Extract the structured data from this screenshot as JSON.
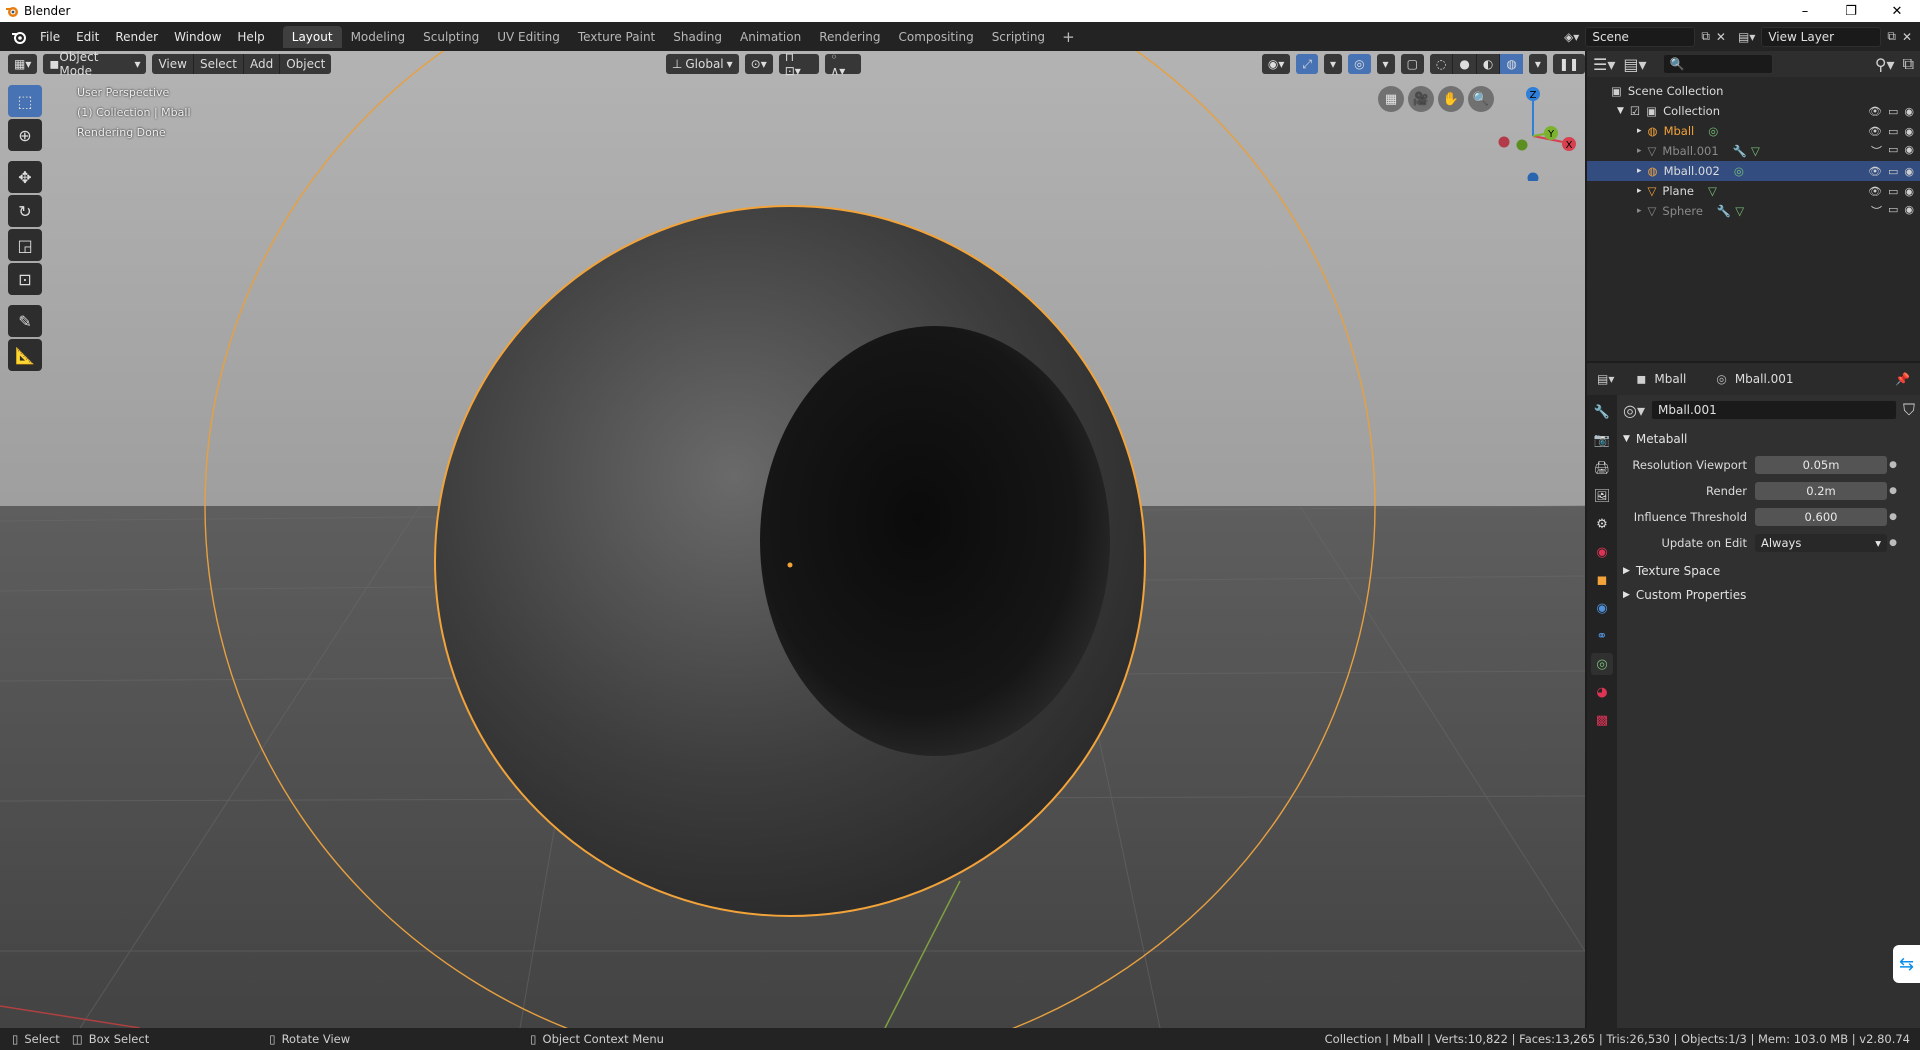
{
  "window": {
    "title": "Blender",
    "min": "–",
    "max": "❐",
    "close": "✕"
  },
  "topbar": {
    "menus": [
      "File",
      "Edit",
      "Render",
      "Window",
      "Help"
    ],
    "tabs": [
      "Layout",
      "Modeling",
      "Sculpting",
      "UV Editing",
      "Texture Paint",
      "Shading",
      "Animation",
      "Rendering",
      "Compositing",
      "Scripting"
    ],
    "active_tab": "Layout",
    "add_tab": "+",
    "scene": "Scene",
    "view_layer": "View Layer"
  },
  "viewport_header": {
    "mode": "Object Mode",
    "menus": [
      "View",
      "Select",
      "Add",
      "Object"
    ],
    "orientation": "Global"
  },
  "viewport_info": {
    "line1": "User Perspective",
    "line2": "(1) Collection | Mball",
    "line3": "Rendering Done"
  },
  "gizmo": {
    "z": "Z",
    "y": "Y",
    "x": "X"
  },
  "outliner": {
    "scene_collection": "Scene Collection",
    "collection": "Collection",
    "items": [
      {
        "name": "Mball",
        "selected": false,
        "active": true,
        "hidden": false
      },
      {
        "name": "Mball.001",
        "selected": false,
        "active": false,
        "hidden": true
      },
      {
        "name": "Mball.002",
        "selected": true,
        "active": false,
        "hidden": false
      },
      {
        "name": "Plane",
        "selected": false,
        "active": false,
        "hidden": false
      },
      {
        "name": "Sphere",
        "selected": false,
        "active": false,
        "hidden": true
      }
    ]
  },
  "properties": {
    "object": "Mball",
    "data": "Mball.001",
    "datablock": "Mball.001",
    "panel": "Metaball",
    "fields": [
      {
        "label": "Resolution Viewport",
        "value": "0.05m"
      },
      {
        "label": "Render",
        "value": "0.2m"
      },
      {
        "label": "Influence Threshold",
        "value": "0.600"
      },
      {
        "label": "Update on Edit",
        "value": "Always"
      }
    ],
    "collapsed_panels": [
      "Texture Space",
      "Custom Properties"
    ]
  },
  "statusbar": {
    "select": "Select",
    "box_select": "Box Select",
    "rotate": "Rotate View",
    "context": "Object Context Menu",
    "stats": "Collection | Mball | Verts:10,822 | Faces:13,265 | Tris:26,530 | Objects:1/3 | Mem: 103.0 MB | v2.80.74"
  },
  "colors": {
    "accent": "#4772b3",
    "selection_outline": "#f2a33a",
    "panel_bg": "#303030"
  }
}
